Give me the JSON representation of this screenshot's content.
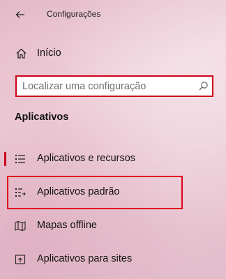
{
  "window": {
    "title": "Configurações"
  },
  "nav": {
    "home_label": "Início"
  },
  "search": {
    "placeholder": "Localizar uma configuração"
  },
  "section": {
    "title": "Aplicativos"
  },
  "menu": [
    {
      "label": "Aplicativos e recursos",
      "icon": "apps-features-icon",
      "selected": true
    },
    {
      "label": "Aplicativos padrão",
      "icon": "default-apps-icon",
      "selected": false
    },
    {
      "label": "Mapas offline",
      "icon": "offline-maps-icon",
      "selected": false
    },
    {
      "label": "Aplicativos para sites",
      "icon": "apps-for-websites-icon",
      "selected": false
    }
  ],
  "colors": {
    "accent": "#d0021b",
    "highlight": "#e0001b"
  }
}
